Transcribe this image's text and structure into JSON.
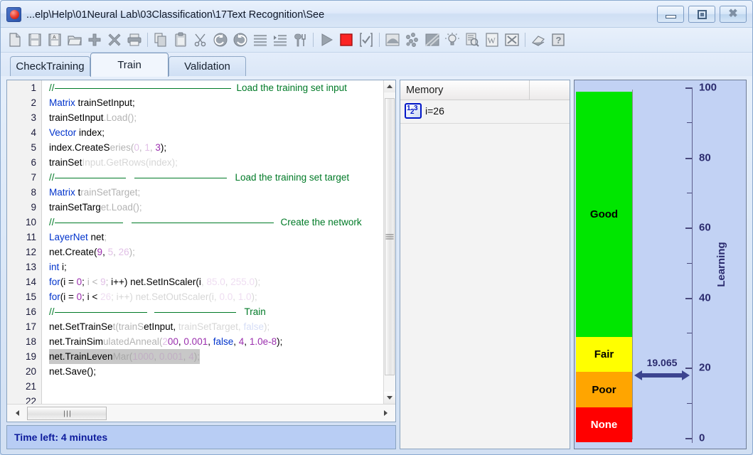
{
  "window": {
    "title": "...elp\\Help\\01Neural Lab\\03Classification\\17Text Recognition\\See",
    "app_icon": "neural-lab-icon",
    "buttons": {
      "minimize": "minimize-icon",
      "maximize": "maximize-icon",
      "close": "close-icon"
    }
  },
  "toolbar": {
    "items": [
      {
        "name": "new-file-icon",
        "glyph": "page"
      },
      {
        "name": "save-icon",
        "glyph": "floppy"
      },
      {
        "name": "save-as-icon",
        "glyph": "floppy-a"
      },
      {
        "name": "open-folder-icon",
        "glyph": "folder"
      },
      {
        "name": "add-icon",
        "glyph": "plus"
      },
      {
        "name": "delete-icon",
        "glyph": "cross"
      },
      {
        "name": "print-icon",
        "glyph": "printer"
      },
      {
        "name": "separator-1",
        "glyph": "sep"
      },
      {
        "name": "copy-icon",
        "glyph": "copy"
      },
      {
        "name": "paste-icon",
        "glyph": "clipboard"
      },
      {
        "name": "cut-icon",
        "glyph": "scissors"
      },
      {
        "name": "undo-icon",
        "glyph": "undo"
      },
      {
        "name": "redo-icon",
        "glyph": "redo"
      },
      {
        "name": "format-lines-icon",
        "glyph": "lines"
      },
      {
        "name": "indent-icon",
        "glyph": "indent"
      },
      {
        "name": "tools-icon",
        "glyph": "tools"
      },
      {
        "name": "separator-2",
        "glyph": "sep"
      },
      {
        "name": "run-icon",
        "glyph": "play"
      },
      {
        "name": "stop-icon",
        "glyph": "stop"
      },
      {
        "name": "check-icon",
        "glyph": "checkbox"
      },
      {
        "name": "separator-3",
        "glyph": "sep"
      },
      {
        "name": "chart-icon",
        "glyph": "chart"
      },
      {
        "name": "scatter-icon",
        "glyph": "scatter"
      },
      {
        "name": "image-icon",
        "glyph": "image"
      },
      {
        "name": "idea-icon",
        "glyph": "bulb"
      },
      {
        "name": "preview-icon",
        "glyph": "preview"
      },
      {
        "name": "export-word-icon",
        "glyph": "word"
      },
      {
        "name": "export-excel-icon",
        "glyph": "excel"
      },
      {
        "name": "separator-4",
        "glyph": "sep"
      },
      {
        "name": "eraser-icon",
        "glyph": "eraser"
      },
      {
        "name": "help-icon",
        "glyph": "question"
      }
    ]
  },
  "tabs": [
    {
      "label": "CheckTraining",
      "active": false
    },
    {
      "label": "Train",
      "active": true
    },
    {
      "label": "Validation",
      "active": false
    }
  ],
  "editor": {
    "line_numbers": [
      "1",
      "2",
      "3",
      "4",
      "5",
      "6",
      "7",
      "8",
      "9",
      "10",
      "11",
      "12",
      "13",
      "14",
      "15",
      "16",
      "17",
      "18",
      "19",
      "20",
      "21",
      "22"
    ],
    "lines": [
      {
        "n": "1",
        "comment_rule": true,
        "comment": "Load the training set input"
      },
      {
        "n": "2",
        "text": "Matrix trainSetInput;"
      },
      {
        "n": "3",
        "text": "trainSetInput.Load();"
      },
      {
        "n": "4",
        "text": "Vector index;"
      },
      {
        "n": "5",
        "text": "index.CreateSeries(0, 1, 3);"
      },
      {
        "n": "6",
        "text": "trainSetInput.GetRows(index);"
      },
      {
        "n": "7",
        "comment_rule": true,
        "comment": "Load the training set target"
      },
      {
        "n": "8",
        "text": "Matrix trainSetTarget;"
      },
      {
        "n": "9",
        "text": "trainSetTarget.Load();"
      },
      {
        "n": "10",
        "comment_rule": true,
        "comment": "Create the network"
      },
      {
        "n": "11",
        "text": "LayerNet net;"
      },
      {
        "n": "12",
        "text": "net.Create(9, 5, 26);"
      },
      {
        "n": "13",
        "text": "int i;"
      },
      {
        "n": "14",
        "text": "for(i = 0; i < 9; i++) net.SetInScaler(i, 85.0, 255.0);"
      },
      {
        "n": "15",
        "text": "for(i = 0; i < 26; i++) net.SetOutScaler(i, 0.0, 1.0);"
      },
      {
        "n": "16",
        "comment_rule": true,
        "comment": "Train"
      },
      {
        "n": "17",
        "text": "net.SetTrainSet(trainSetInput, trainSetTarget, false);"
      },
      {
        "n": "18",
        "text": "net.TrainSimulatedAnneal(200, 0.001, false, 4, 1.0e-8);"
      },
      {
        "n": "19",
        "text": "net.TrainLevenMar(1000, 0.001, 4);",
        "highlighted": true
      },
      {
        "n": "20",
        "text": "net.Save();"
      },
      {
        "n": "21",
        "text": ""
      },
      {
        "n": "22",
        "text": ""
      }
    ],
    "vscroll": {
      "up": "scroll-up-arrow",
      "down": "scroll-down-arrow"
    },
    "hscroll": {
      "left": "scroll-left-arrow",
      "right": "scroll-right-arrow"
    }
  },
  "status": {
    "text": "Time left: 4 minutes"
  },
  "memory": {
    "header": "Memory",
    "rows": [
      {
        "icon": "integer-variable-icon",
        "value": "i=26"
      }
    ]
  },
  "chart_data": {
    "type": "bar",
    "title": "Learning",
    "ylabel": "Learning",
    "ylim": [
      0,
      100
    ],
    "ticks_major": [
      0,
      20,
      40,
      60,
      80,
      100
    ],
    "ticks_minor": [
      10,
      30,
      50,
      70,
      90
    ],
    "tick_labels": [
      "0",
      "20",
      "40",
      "60",
      "80",
      "100"
    ],
    "grid": false,
    "categories": [
      "None",
      "Poor",
      "Fair",
      "Good"
    ],
    "bands": [
      {
        "label": "None",
        "from": 0,
        "to": 10,
        "color": "#ff0000",
        "text_color": "#ffffff"
      },
      {
        "label": "Poor",
        "from": 10,
        "to": 20,
        "color": "#ffa500",
        "text_color": "#000000"
      },
      {
        "label": "Fair",
        "from": 20,
        "to": 30,
        "color": "#ffff00",
        "text_color": "#000000"
      },
      {
        "label": "Good",
        "from": 30,
        "to": 100,
        "color": "#00e600",
        "text_color": "#000000"
      }
    ],
    "marker": {
      "value": 19.065,
      "label": "19.065",
      "color": "#3c4490"
    }
  },
  "colors": {
    "accent": "#3c4490",
    "good": "#00e600",
    "fair": "#ffff00",
    "poor": "#ffa500",
    "none": "#ff0000",
    "status_bg": "#b8cdf4",
    "status_fg": "#0d1b9c",
    "panel_bg": "#c2d2f4"
  }
}
